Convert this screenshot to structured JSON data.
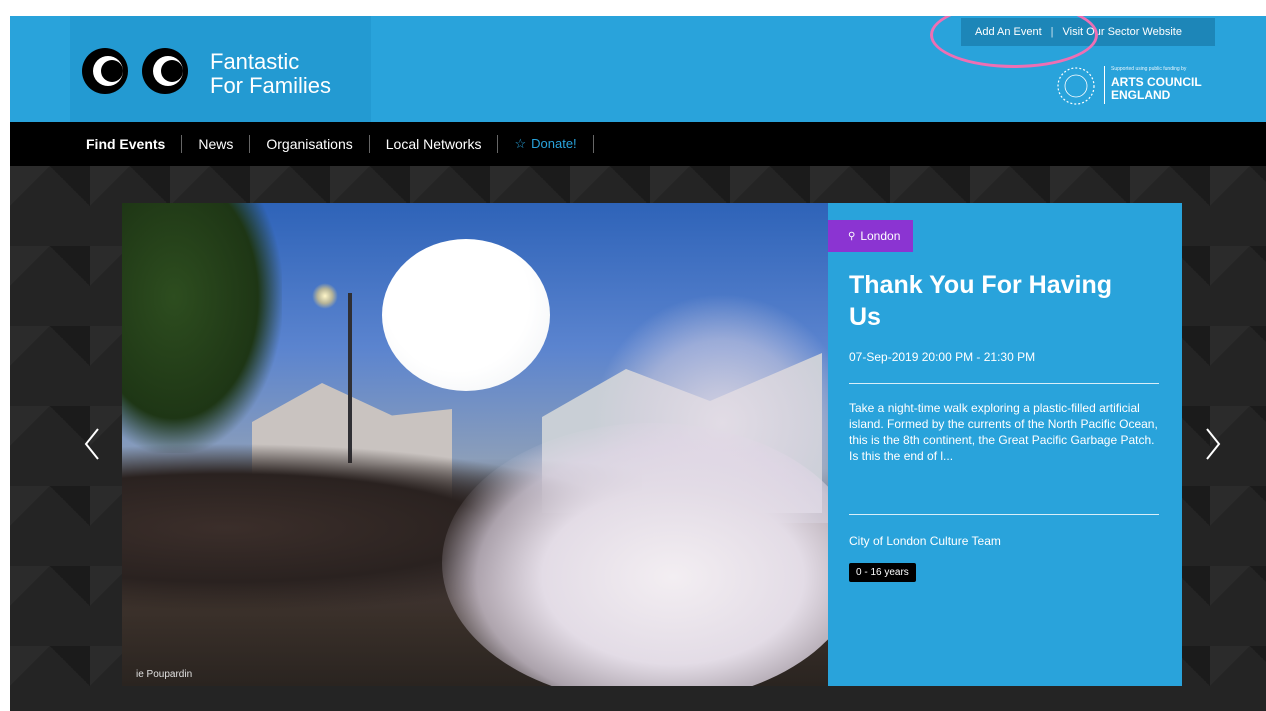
{
  "brand": {
    "logo_line1": "Fantastic",
    "logo_line2": "For Families",
    "header_color": "#29a3db"
  },
  "top_links": {
    "add_event": "Add An Event",
    "sector_site": "Visit Our Sector Website"
  },
  "sponsor": {
    "small_text": "Supported using public funding by",
    "line1": "ARTS COUNCIL",
    "line2": "ENGLAND"
  },
  "nav": {
    "items": [
      {
        "label": "Find Events"
      },
      {
        "label": "News"
      },
      {
        "label": "Organisations"
      },
      {
        "label": "Local Networks"
      },
      {
        "label": "Donate!"
      }
    ]
  },
  "slide": {
    "location": "London",
    "title": "Thank You For Having Us",
    "datetime": "07-Sep-2019 20:00 PM - 21:30 PM",
    "description": "Take a night-time walk exploring a plastic-filled artificial island. Formed by the currents of the North Pacific Ocean, this is the 8th continent, the Great Pacific Garbage Patch. Is this the end of l...",
    "organiser": "City of London Culture Team",
    "age_range": "0 - 16 years",
    "photo_credit": "ie Poupardin",
    "location_color": "#8b34d2"
  },
  "icons": {
    "prev": "chevron-left-icon",
    "next": "chevron-right-icon",
    "pin": "map-pin-icon",
    "star": "star-outline-icon"
  }
}
